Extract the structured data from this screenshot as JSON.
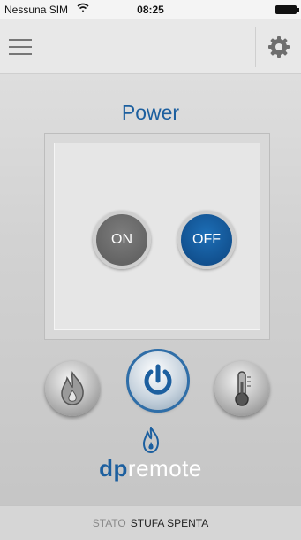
{
  "status_bar": {
    "carrier": "Nessuna SIM",
    "time": "08:25",
    "wifi_icon": "wifi-icon",
    "battery_icon": "battery-icon"
  },
  "nav": {
    "menu_icon": "hamburger-menu-icon",
    "settings_icon": "gear-icon"
  },
  "main": {
    "title": "Power",
    "on_label": "ON",
    "off_label": "OFF",
    "selected": "OFF"
  },
  "modes": [
    {
      "icon": "flame-icon"
    },
    {
      "icon": "power-icon",
      "active": true
    },
    {
      "icon": "thermometer-icon"
    }
  ],
  "brand": {
    "prefix": "dp",
    "suffix": "remote",
    "icon": "flame-logo-icon"
  },
  "footer": {
    "label": "STATO",
    "value": "STUFA SPENTA"
  },
  "colors": {
    "accent": "#1c5f9f",
    "off_button": "#114f8d",
    "on_button": "#646464"
  }
}
